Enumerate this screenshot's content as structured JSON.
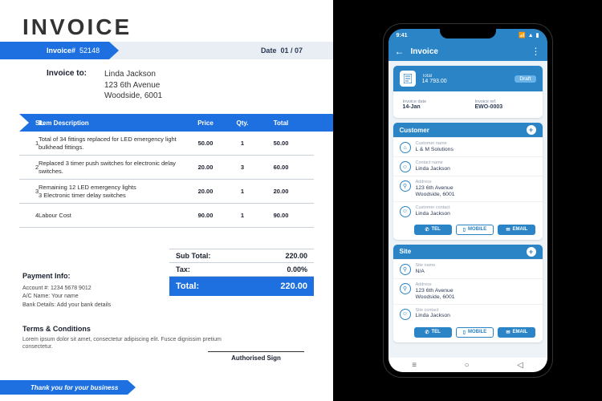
{
  "invoice": {
    "title": "INVOICE",
    "number_label": "Invoice#",
    "number": "52148",
    "date_label": "Date",
    "date": "01 / 07",
    "to_label": "Invoice to:",
    "to_name": "Linda Jackson",
    "to_addr1": "123 6th Avenue",
    "to_addr2": "Woodside, 6001",
    "col_sl": "SL.",
    "col_desc": "Item Description",
    "col_price": "Price",
    "col_qty": "Qty.",
    "col_total": "Total",
    "rows": [
      {
        "sl": "1",
        "desc": "Total of 34 fittings replaced for LED emergency light bulkhead fittings.",
        "price": "50.00",
        "qty": "1",
        "total": "50.00"
      },
      {
        "sl": "2",
        "desc": "Replaced 3 timer push switches for electronic delay switches.",
        "price": "20.00",
        "qty": "3",
        "total": "60.00"
      },
      {
        "sl": "3",
        "desc": "Remaining 12 LED emergency lights\n3 Electronic timer delay switches",
        "price": "20.00",
        "qty": "1",
        "total": "20.00"
      },
      {
        "sl": "4",
        "desc": "Labour Cost",
        "price": "90.00",
        "qty": "1",
        "total": "90.00"
      }
    ],
    "subtotal_label": "Sub Total:",
    "subtotal": "220.00",
    "tax_label": "Tax:",
    "tax": "0.00%",
    "total_label": "Total:",
    "total": "220.00",
    "pay_title": "Payment Info:",
    "pay_acct": "Account #:   1234 5678 9012",
    "pay_name": "A/C Name:   Your name",
    "pay_bank": "Bank Details:   Add your bank details",
    "terms_title": "Terms & Conditions",
    "terms_body": "Lorem ipsum dolor sit amet, consectetur adipiscing elit. Fusce dignissim pretium consectetur.",
    "sign": "Authorised Sign",
    "thank": "Thank you for your business"
  },
  "app": {
    "time": "9:41",
    "title": "Invoice",
    "total_label": "Total",
    "total_amount": "14 793.00",
    "status": "Draft",
    "inv_date_label": "Invoice date",
    "inv_date": "14-Jan",
    "inv_ref_label": "Invoice ref.",
    "inv_ref": "EWO-0003",
    "customer_title": "Customer",
    "cust_name_label": "Customer name",
    "cust_name": "L & M Solutions",
    "contact_label": "Contact name",
    "contact": "Linda Jackson",
    "addr_label": "Address",
    "addr": "123 6th Avenue\nWoodside, 6001",
    "cust_contact_label": "Customer contact",
    "cust_contact": "Linda Jackson",
    "site_title": "Site",
    "site_name_label": "Site name",
    "site_name": "N/A",
    "site_addr": "123 6th Avenue\nWoodside, 6001",
    "site_contact_label": "Site contact",
    "site_contact": "Linda Jackson",
    "btn_tel": "TEL",
    "btn_mobile": "MOBILE",
    "btn_email": "EMAIL"
  }
}
